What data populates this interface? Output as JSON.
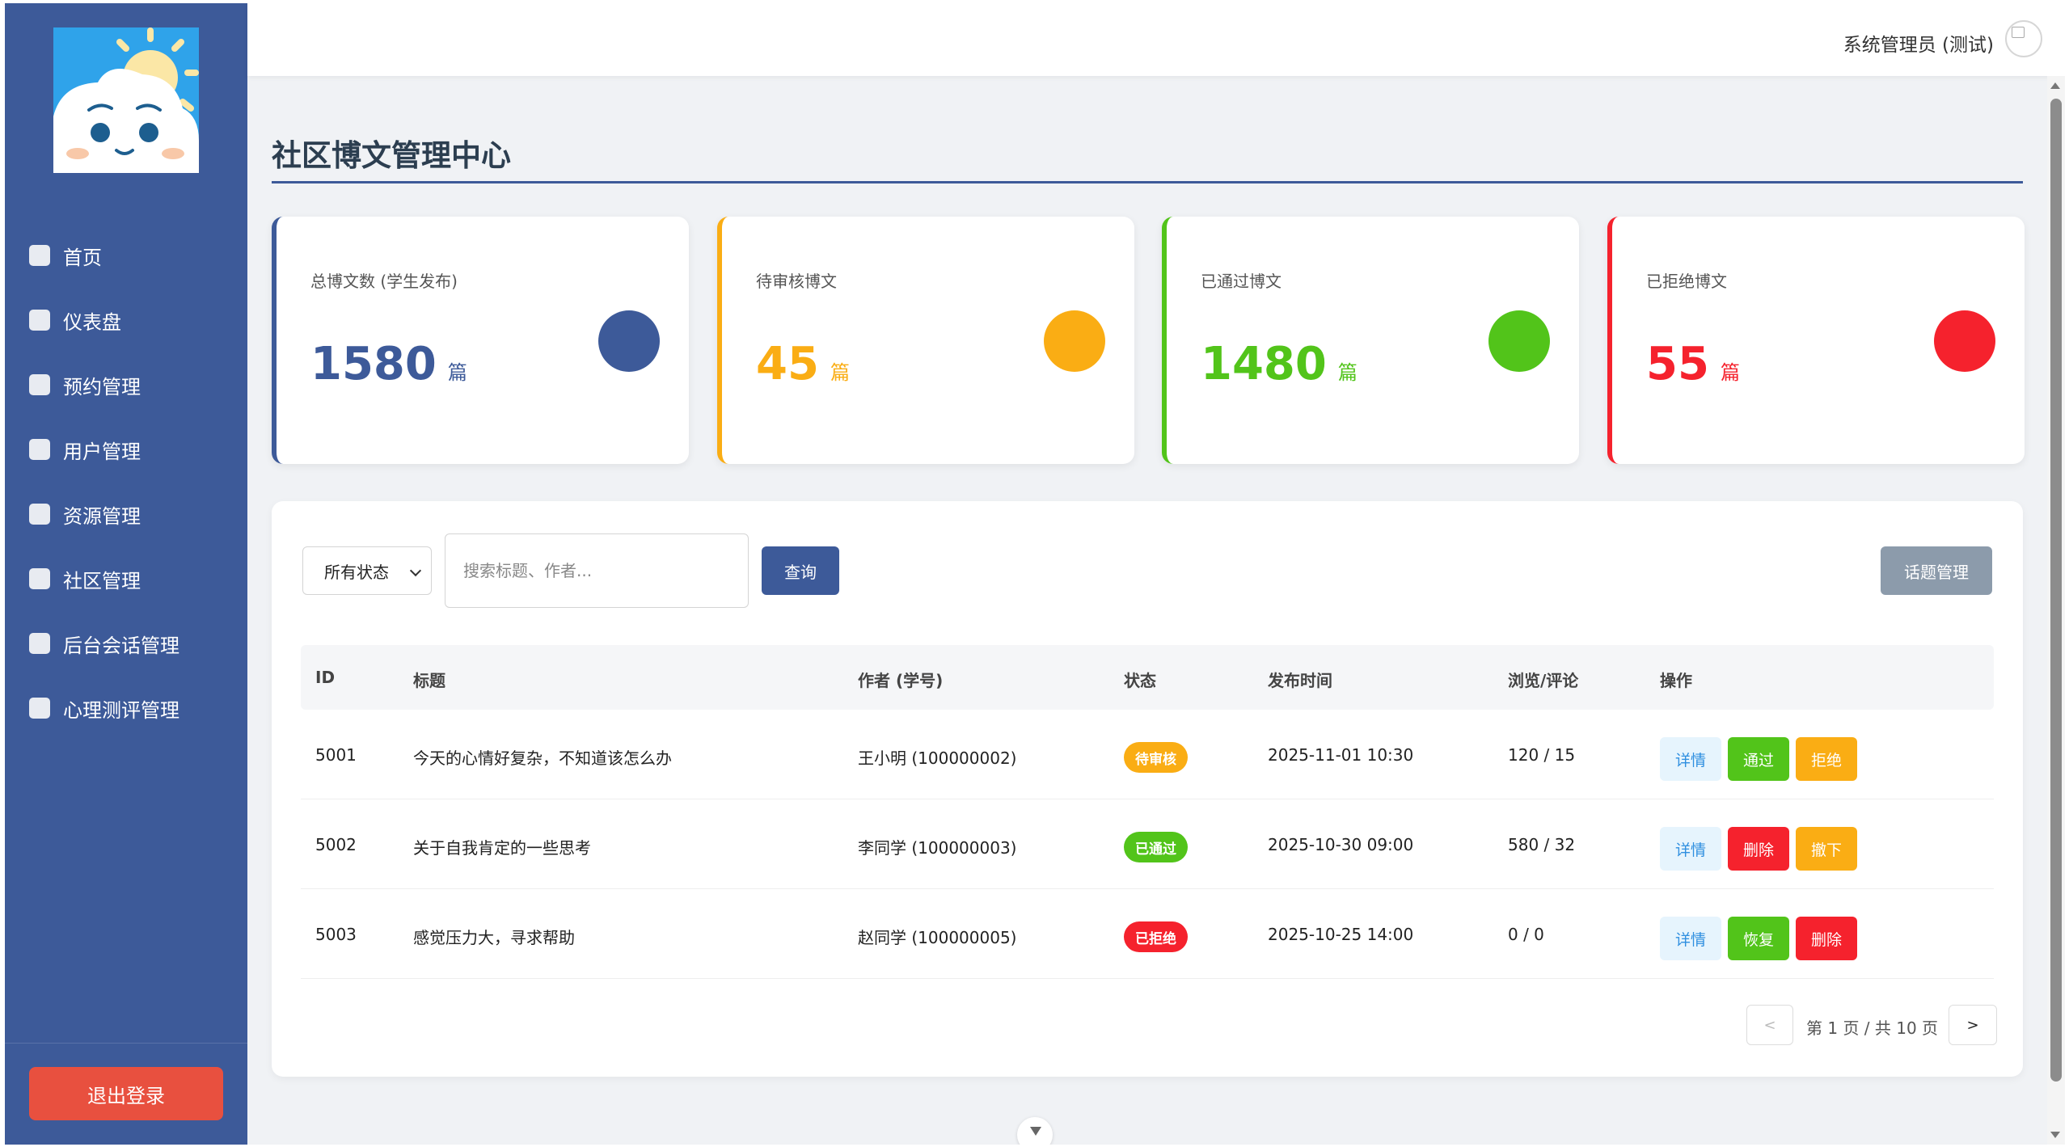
{
  "sidebar": {
    "logo": "cloud-sun-mascot",
    "items": [
      {
        "label": "首页"
      },
      {
        "label": "仪表盘"
      },
      {
        "label": "预约管理"
      },
      {
        "label": "用户管理"
      },
      {
        "label": "资源管理"
      },
      {
        "label": "社区管理"
      },
      {
        "label": "后台会话管理"
      },
      {
        "label": "心理测评管理"
      }
    ],
    "logout_label": "退出登录"
  },
  "header": {
    "user_name": "系统管理员 (测试)",
    "avatar_icon": "avatar-broken-image-icon"
  },
  "page": {
    "title": "社区博文管理中心"
  },
  "stats": [
    {
      "label": "总博文数 (学生发布)",
      "value": "1580",
      "unit": "篇",
      "color": "#3d5a99"
    },
    {
      "label": "待审核博文",
      "value": "45",
      "unit": "篇",
      "color": "#faad14"
    },
    {
      "label": "已通过博文",
      "value": "1480",
      "unit": "篇",
      "color": "#52c41a"
    },
    {
      "label": "已拒绝博文",
      "value": "55",
      "unit": "篇",
      "color": "#f5222d"
    }
  ],
  "filters": {
    "status_selected": "所有状态",
    "search_placeholder": "搜索标题、作者...",
    "query_label": "查询",
    "topic_label": "话题管理"
  },
  "table": {
    "headers": {
      "id": "ID",
      "title": "标题",
      "author": "作者 (学号)",
      "status": "状态",
      "time": "发布时间",
      "stats": "浏览/评论",
      "actions": "操作"
    },
    "rows": [
      {
        "id": "5001",
        "title": "今天的心情好复杂，不知道该怎么办",
        "author": "王小明 (100000002)",
        "status": "待审核",
        "status_color": "#faad14",
        "time": "2025-11-01 10:30",
        "stats": "120 / 15",
        "actions": [
          "详情",
          "通过",
          "拒绝"
        ]
      },
      {
        "id": "5002",
        "title": "关于自我肯定的一些思考",
        "author": "李同学 (100000003)",
        "status": "已通过",
        "status_color": "#52c41a",
        "time": "2025-10-30 09:00",
        "stats": "580 / 32",
        "actions": [
          "详情",
          "删除",
          "撤下"
        ]
      },
      {
        "id": "5003",
        "title": "感觉压力大，寻求帮助",
        "author": "赵同学 (100000005)",
        "status": "已拒绝",
        "status_color": "#f5222d",
        "time": "2025-10-25 14:00",
        "stats": "0 / 0",
        "actions": [
          "详情",
          "恢复",
          "删除"
        ]
      }
    ]
  },
  "pagination": {
    "prev": "<",
    "info": "第 1 页 / 共 10 页",
    "next": ">"
  }
}
